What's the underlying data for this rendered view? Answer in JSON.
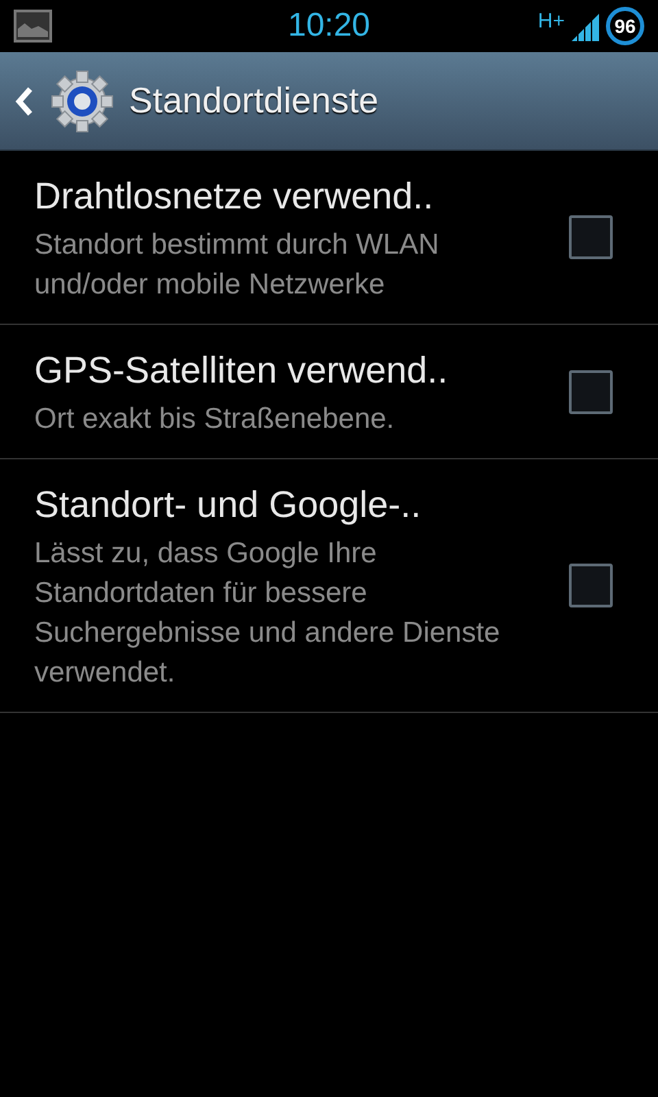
{
  "status_bar": {
    "time": "10:20",
    "network": "H+",
    "battery": "96"
  },
  "action_bar": {
    "title": "Standortdienste"
  },
  "settings": [
    {
      "title": "Drahtlosnetze verwend..",
      "summary": "Standort bestimmt durch WLAN und/oder mobile Netzwerke",
      "checked": false
    },
    {
      "title": "GPS-Satelliten verwend..",
      "summary": "Ort exakt bis Straßenebene.",
      "checked": false
    },
    {
      "title": "Standort- und Google-..",
      "summary": "Lässt zu, dass Google Ihre Standortdaten für bessere Suchergebnisse und andere Dienste verwendet.",
      "checked": false
    }
  ]
}
